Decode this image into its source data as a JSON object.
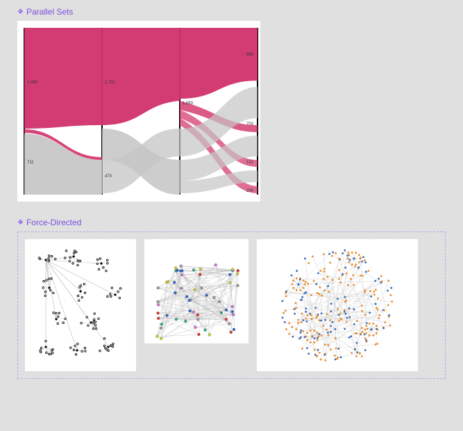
{
  "sections": {
    "parallel": {
      "title": "Parallel Sets"
    },
    "force": {
      "title": "Force-Directed"
    }
  },
  "chart_data": [
    {
      "type": "parallel-sets",
      "title": "Parallel Sets",
      "axes": [
        {
          "categories": [
            {
              "label": "1,490",
              "size": 1490,
              "color": "#d1316a"
            },
            {
              "label": "711",
              "size": 711,
              "color": "#c0c0c0"
            }
          ]
        },
        {
          "categories": [
            {
              "label": "1,731",
              "size": 1731,
              "color": "mixed"
            },
            {
              "label": "470",
              "size": 470,
              "color": "mixed"
            }
          ]
        },
        {
          "categories": [
            {
              "label": "1,093",
              "size": 1093
            },
            {
              "label": "",
              "size": 120
            },
            {
              "label": "",
              "size": 180
            },
            {
              "label": "",
              "size": 400
            },
            {
              "label": "",
              "size": 280
            },
            {
              "label": "",
              "size": 128
            }
          ]
        },
        {
          "categories": [
            {
              "label": "885",
              "size": 885
            },
            {
              "label": "",
              "size": 160
            },
            {
              "label": "703",
              "size": 703
            },
            {
              "label": "",
              "size": 130
            },
            {
              "label": "151",
              "size": 151
            },
            {
              "label": "",
              "size": 60
            },
            {
              "label": "200",
              "size": 200
            }
          ]
        }
      ],
      "primary_color": "#d1316a",
      "secondary_color": "#c0c0c0"
    },
    {
      "type": "force-directed",
      "title": "Force-Directed cluster graph",
      "description": "Several small dense black-node clusters connected by thin gray edges into a sparse tree",
      "approx_nodes": 140,
      "approx_edges": 160,
      "node_color": "#000000",
      "edge_color": "#bbbbbb"
    },
    {
      "type": "force-directed",
      "title": "Force-Directed colored groups",
      "description": "Multi-colored nodes (red, green, yellow, blue, gray) with many gray edges forming a dense triangular layout",
      "approx_nodes": 70,
      "approx_edges": 250,
      "palette": [
        "#d33",
        "#3a8",
        "#cc3",
        "#36c",
        "#999"
      ]
    },
    {
      "type": "force-directed",
      "title": "Force-Directed bipartite ring",
      "description": "Large circular layout of alternating orange and blue nodes with sparse gray links and a few small hub wheels",
      "approx_nodes": 260,
      "approx_edges": 300,
      "palette": [
        "#e88b2d",
        "#3768b3"
      ],
      "edge_color": "#cccccc"
    }
  ]
}
